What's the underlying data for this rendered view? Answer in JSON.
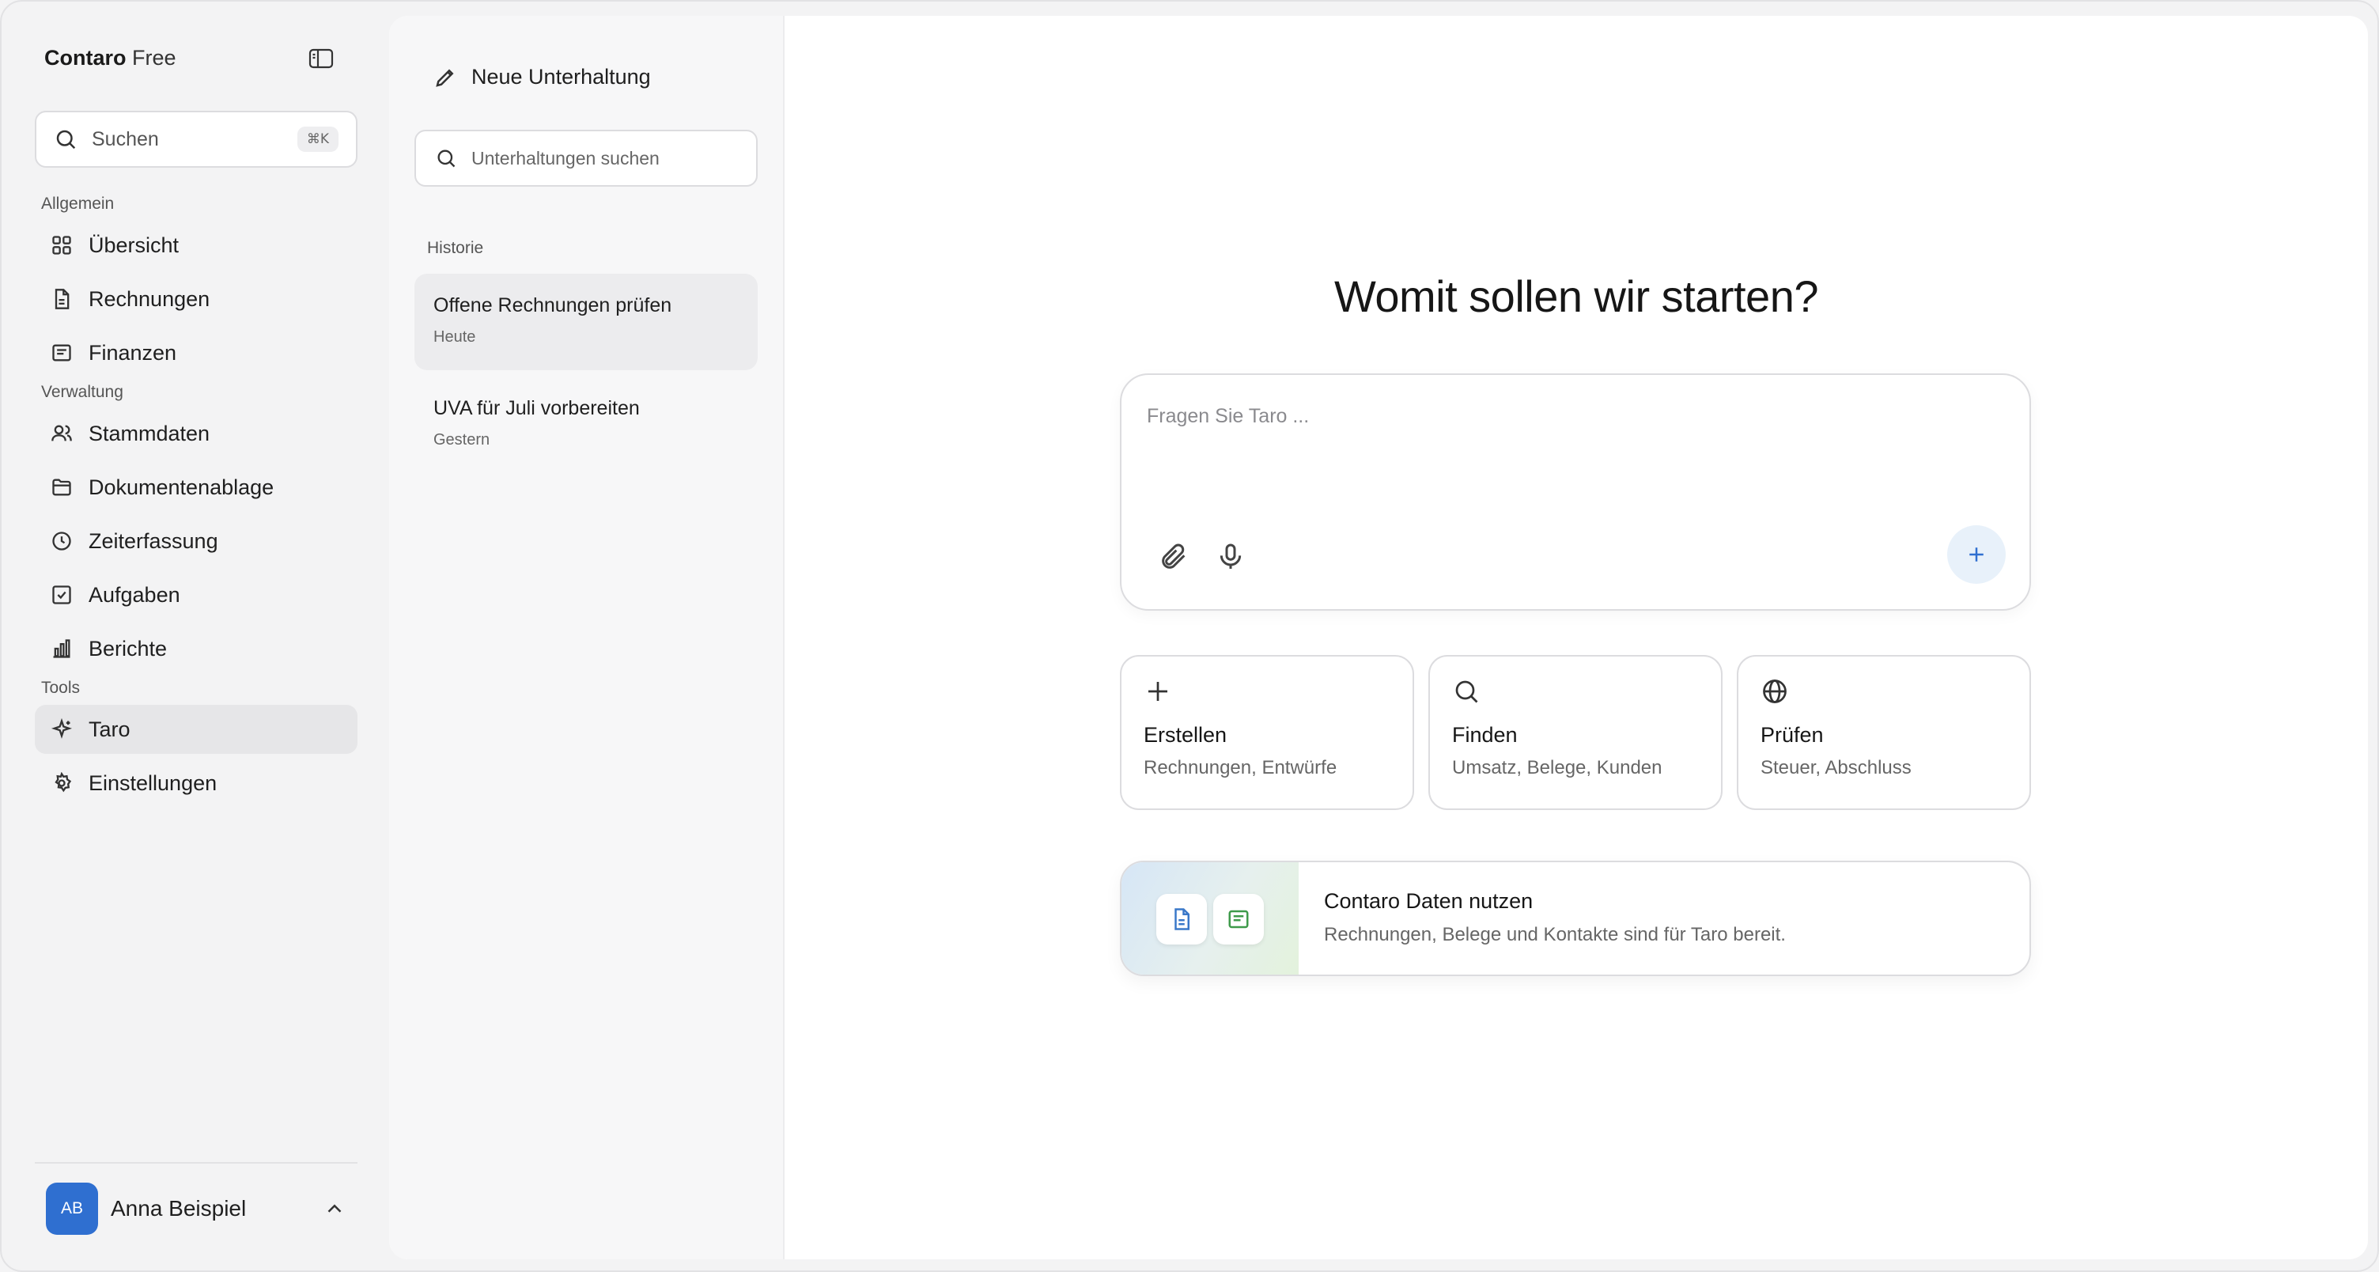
{
  "brand": {
    "name": "Contaro",
    "plan": "Free"
  },
  "sidebar": {
    "search_label": "Suchen",
    "search_shortcut": "⌘K",
    "sections": {
      "general": "Allgemein",
      "admin": "Verwaltung",
      "tools": "Tools"
    },
    "items": [
      {
        "label": "Übersicht",
        "icon": "grid-icon"
      },
      {
        "label": "Rechnungen",
        "icon": "document-icon"
      },
      {
        "label": "Finanzen",
        "icon": "receipt-icon"
      },
      {
        "label": "Stammdaten",
        "icon": "users-icon"
      },
      {
        "label": "Dokumentenablage",
        "icon": "folder-icon"
      },
      {
        "label": "Zeiterfassung",
        "icon": "clock-icon"
      },
      {
        "label": "Aufgaben",
        "icon": "checkbox-icon"
      },
      {
        "label": "Berichte",
        "icon": "bar-chart-icon"
      },
      {
        "label": "Taro",
        "icon": "sparkle-icon",
        "active": true
      },
      {
        "label": "Einstellungen",
        "icon": "gear-icon"
      }
    ],
    "user": {
      "initials": "AB",
      "name": "Anna Beispiel"
    }
  },
  "conversations": {
    "new_label": "Neue Unterhaltung",
    "search_placeholder": "Unterhaltungen suchen",
    "history_label": "Historie",
    "items": [
      {
        "title": "Offene Rechnungen prüfen",
        "date": "Heute",
        "active": true
      },
      {
        "title": "UVA für Juli vorbereiten",
        "date": "Gestern"
      }
    ]
  },
  "chat": {
    "headline": "Womit sollen wir starten?",
    "placeholder": "Fragen Sie Taro ...",
    "actions": [
      {
        "title": "Erstellen",
        "subtitle": "Rechnungen, Entwürfe",
        "icon": "plus-icon"
      },
      {
        "title": "Finden",
        "subtitle": "Umsatz, Belege, Kunden",
        "icon": "search-icon"
      },
      {
        "title": "Prüfen",
        "subtitle": "Steuer, Abschluss",
        "icon": "globe-icon"
      }
    ],
    "banner": {
      "title": "Contaro Daten nutzen",
      "subtitle": "Rechnungen, Belege und Kontakte sind für Taro bereit."
    }
  },
  "colors": {
    "accent": "#2f6fd0",
    "send_bg": "#e8f1fa",
    "doc_blue": "#3a78c9",
    "doc_green": "#3e9a4a"
  }
}
